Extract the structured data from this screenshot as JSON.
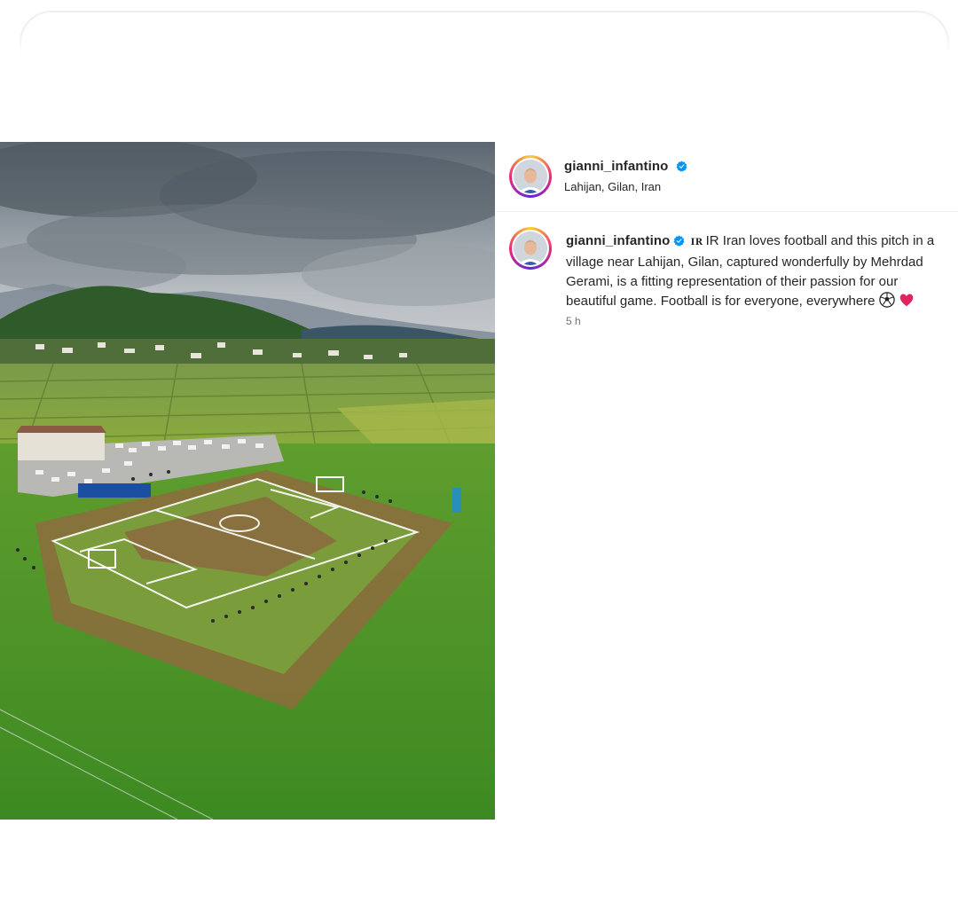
{
  "post": {
    "image_alt": "aerial-football-pitch-photo",
    "author": {
      "username": "gianni_infantino",
      "verified": true,
      "location": "Lahijan, Gilan, Iran"
    },
    "caption": {
      "username": "gianni_infantino",
      "flag_code": "IR",
      "lines": [
        "IR Iran loves football and this pitch in a",
        "village near Lahijan, Gilan, captured wonderfully by Mehrdad",
        "Gerami, is a fitting representation of their passion for our",
        "beautiful game. Football is for everyone, everywhere"
      ],
      "emojis": [
        "soccer-ball-icon",
        "red-heart-icon"
      ]
    },
    "timestamp": "5 h"
  },
  "colors": {
    "verified_badge": "#0095f6",
    "text_primary": "#262626",
    "text_secondary": "#737373",
    "divider": "#efefef",
    "heart": "#e0245e"
  }
}
